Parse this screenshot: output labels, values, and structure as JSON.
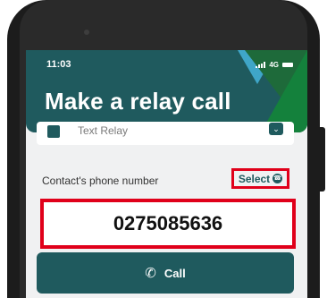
{
  "status": {
    "time": "11:03",
    "network": "4G"
  },
  "header": {
    "title": "Make a relay call"
  },
  "relay": {
    "label": "Text Relay",
    "icon": "relay-icon",
    "chevron_icon": "chevron-down-icon"
  },
  "contact": {
    "label": "Contact's phone number",
    "select_label": "Select",
    "select_icon": "contact-icon",
    "phone_value": "0275085636"
  },
  "call": {
    "label": "Call",
    "icon": "phone-icon"
  },
  "colors": {
    "brand": "#1f5a5e",
    "highlight": "#e0001a",
    "accent_green": "#14813c",
    "accent_blue": "#3fa6c8"
  }
}
